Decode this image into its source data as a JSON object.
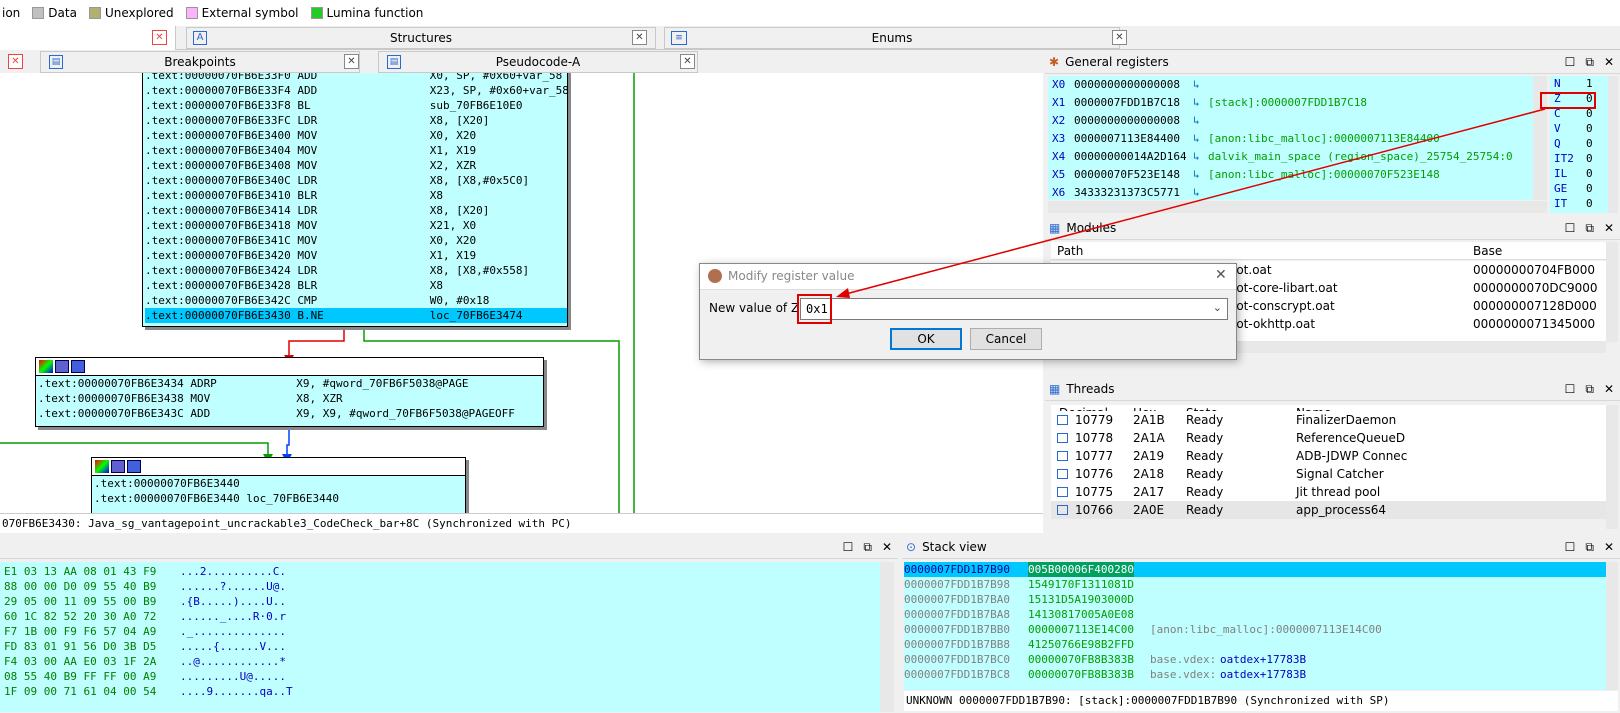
{
  "legend": [
    {
      "label": "ion",
      "color": "#c0c0c0"
    },
    {
      "label": "Data",
      "color": "#c0c0c0"
    },
    {
      "label": "Unexplored",
      "color": "#b0b070"
    },
    {
      "label": "External symbol",
      "color": "#ffb0ff"
    },
    {
      "label": "Lumina function",
      "color": "#22cc22"
    }
  ],
  "tabs_top": {
    "structures": "Structures",
    "enums": "Enums"
  },
  "tabs_second": {
    "breakpoints": "Breakpoints",
    "pseudocode": "Pseudocode-A"
  },
  "disasm_main": [
    ".text:00000070FB6E33F0 ADD                 X0, SP, #0x60+var_58",
    ".text:00000070FB6E33F4 ADD                 X23, SP, #0x60+var_58",
    ".text:00000070FB6E33F8 BL                  sub_70FB6E10E0",
    ".text:00000070FB6E33FC LDR                 X8, [X20]",
    ".text:00000070FB6E3400 MOV                 X0, X20",
    ".text:00000070FB6E3404 MOV                 X1, X19",
    ".text:00000070FB6E3408 MOV                 X2, XZR",
    ".text:00000070FB6E340C LDR                 X8, [X8,#0x5C0]",
    ".text:00000070FB6E3410 BLR                 X8",
    ".text:00000070FB6E3414 LDR                 X8, [X20]",
    ".text:00000070FB6E3418 MOV                 X21, X0",
    ".text:00000070FB6E341C MOV                 X0, X20",
    ".text:00000070FB6E3420 MOV                 X1, X19",
    ".text:00000070FB6E3424 LDR                 X8, [X8,#0x558]",
    ".text:00000070FB6E3428 BLR                 X8",
    ".text:00000070FB6E342C CMP                 W0, #0x18",
    ".text:00000070FB6E3430 B.NE                loc_70FB6E3474"
  ],
  "disasm_node2": [
    ".text:00000070FB6E3434 ADRP            X9, #qword_70FB6F5038@PAGE",
    ".text:00000070FB6E3438 MOV             X8, XZR",
    ".text:00000070FB6E343C ADD             X9, X9, #qword_70FB6F5038@PAGEOFF"
  ],
  "disasm_node3": [
    ".text:00000070FB6E3440",
    ".text:00000070FB6E3440 loc_70FB6E3440"
  ],
  "disasm_status": "070FB6E3430: Java_sg_vantagepoint_uncrackable3_CodeCheck_bar+8C (Synchronized with PC)",
  "registers": {
    "title": "General registers",
    "rows": [
      {
        "name": "X0",
        "value": "0000000000000008",
        "ref": ""
      },
      {
        "name": "X1",
        "value": "0000007FDD1B7C18",
        "ref": "[stack]:0000007FDD1B7C18"
      },
      {
        "name": "X2",
        "value": "0000000000000008",
        "ref": ""
      },
      {
        "name": "X3",
        "value": "0000007113E84400",
        "ref": "[anon:libc_malloc]:0000007113E84400"
      },
      {
        "name": "X4",
        "value": "00000000014A2D164",
        "ref": "dalvik_main_space (region_space)_25754_25754:0"
      },
      {
        "name": "X5",
        "value": "00000070F523E148",
        "ref": "[anon:libc_malloc]:00000070F523E148"
      },
      {
        "name": "X6",
        "value": "34333231373C5771",
        "ref": ""
      }
    ],
    "flags": [
      {
        "name": "N",
        "value": "1"
      },
      {
        "name": "Z",
        "value": "0"
      },
      {
        "name": "C",
        "value": "0"
      },
      {
        "name": "V",
        "value": "0"
      },
      {
        "name": "Q",
        "value": "0"
      },
      {
        "name": "IT2",
        "value": "0"
      },
      {
        "name": "IL",
        "value": "0"
      },
      {
        "name": "GE",
        "value": "0"
      },
      {
        "name": "IT",
        "value": "0"
      }
    ]
  },
  "modules": {
    "title": "Modules",
    "col_path": "Path",
    "col_base": "Base",
    "rows": [
      {
        "path": "oot.oat",
        "base": "00000000704FB000"
      },
      {
        "path": "oot-core-libart.oat",
        "base": "0000000070DC9000"
      },
      {
        "path": "oot-conscrypt.oat",
        "base": "000000007128D000"
      },
      {
        "path": "oot-okhttp.oat",
        "base": "0000000071345000"
      }
    ]
  },
  "dialog": {
    "title": "Modify register value",
    "label": "New value of Z",
    "value": "0x1",
    "ok": "OK",
    "cancel": "Cancel"
  },
  "threads": {
    "title": "Threads",
    "cols": [
      "Decimal",
      "Hex",
      "State",
      "Name"
    ],
    "rows": [
      {
        "dec": "10779",
        "hex": "2A1B",
        "state": "Ready",
        "name": "FinalizerDaemon"
      },
      {
        "dec": "10778",
        "hex": "2A1A",
        "state": "Ready",
        "name": "ReferenceQueueD"
      },
      {
        "dec": "10777",
        "hex": "2A19",
        "state": "Ready",
        "name": "ADB-JDWP Connec"
      },
      {
        "dec": "10776",
        "hex": "2A18",
        "state": "Ready",
        "name": "Signal Catcher"
      },
      {
        "dec": "10775",
        "hex": "2A17",
        "state": "Ready",
        "name": "Jit thread pool"
      },
      {
        "dec": "10766",
        "hex": "2A0E",
        "state": "Ready",
        "name": "app_process64"
      }
    ]
  },
  "hex": {
    "rows": [
      {
        "bytes": "E1 03 13 AA 08 01 43 F9",
        "ascii": "...2..........C."
      },
      {
        "bytes": "88 00 00 D0 09 55 40 B9",
        "ascii": "......?......U@."
      },
      {
        "bytes": "29 05 00 11 09 55 00 B9",
        "ascii": ".{B.....)....U.."
      },
      {
        "bytes": "60 1C 82 52 20 30 A0 72",
        "ascii": "......_....R·0.r"
      },
      {
        "bytes": "F7 1B 00 F9 F6 57 04 A9",
        "ascii": "._.............."
      },
      {
        "bytes": "FD 83 01 91 56 D0 3B D5",
        "ascii": ".....{......V..."
      },
      {
        "bytes": "F4 03 00 AA E0 03 1F 2A",
        "ascii": "..@............*"
      },
      {
        "bytes": "08 55 40 B9 FF FF 00 A9",
        "ascii": ".........U@....."
      },
      {
        "bytes": "1F 09 00 71 61 04 00 54",
        "ascii": "....9.......qa..T"
      }
    ]
  },
  "stack": {
    "title": "Stack view",
    "rows": [
      {
        "addr": "0000007FDD1B7B90",
        "val": "005B00006F400280",
        "ref": "",
        "refv": ""
      },
      {
        "addr": "0000007FDD1B7B98",
        "val": "1549170F1311081D",
        "ref": "",
        "refv": ""
      },
      {
        "addr": "0000007FDD1B7BA0",
        "val": "15131D5A1903000D",
        "ref": "",
        "refv": ""
      },
      {
        "addr": "0000007FDD1B7BA8",
        "val": "14130817005A0E08",
        "ref": "",
        "refv": ""
      },
      {
        "addr": "0000007FDD1B7BB0",
        "val": "0000007113E14C00",
        "ref": "[anon:libc_malloc]:0000007113E14C00",
        "refv": ""
      },
      {
        "addr": "0000007FDD1B7BB8",
        "val": "41250766E98B2FFD",
        "ref": "",
        "refv": ""
      },
      {
        "addr": "0000007FDD1B7BC0",
        "val": "00000070FB8B383B",
        "ref": "base.vdex:",
        "refv": "oatdex+17783B"
      },
      {
        "addr": "0000007FDD1B7BC8",
        "val": "00000070FB8B383B",
        "ref": "base.vdex:",
        "refv": "oatdex+17783B"
      }
    ],
    "status": "UNKNOWN 0000007FDD1B7B90: [stack]:0000007FDD1B7B90 (Synchronized with SP)"
  }
}
